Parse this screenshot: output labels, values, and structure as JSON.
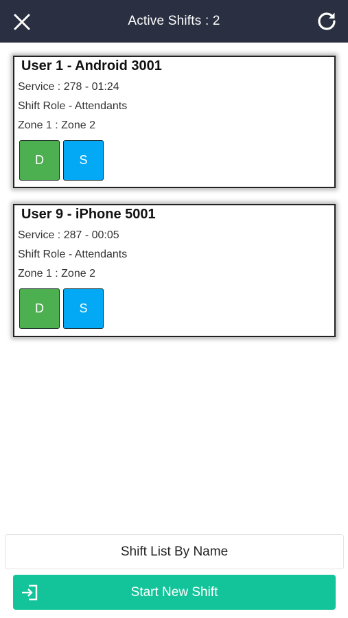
{
  "header": {
    "title": "Active Shifts : 2",
    "close_icon": "close-icon",
    "refresh_icon": "refresh-icon",
    "background": "#2a3042"
  },
  "shifts": [
    {
      "name": "User 1 - Android 3001",
      "service": "Service : 278 - 01:24",
      "role": "Shift Role - Attendants",
      "zones": "Zone 1 : Zone 2",
      "buttons": {
        "d_label": "D",
        "s_label": "S"
      }
    },
    {
      "name": "User 9 - iPhone 5001",
      "service": "Service : 287 - 00:05",
      "role": "Shift Role - Attendants",
      "zones": "Zone 1 : Zone 2",
      "buttons": {
        "d_label": "D",
        "s_label": "S"
      }
    }
  ],
  "footer": {
    "list_by_name_label": "Shift List By Name",
    "start_new_shift_label": "Start New Shift",
    "start_icon": "login-arrow-icon"
  },
  "colors": {
    "d_button": "#4caf50",
    "s_button": "#03a9f4",
    "start_button": "#13c49a"
  }
}
